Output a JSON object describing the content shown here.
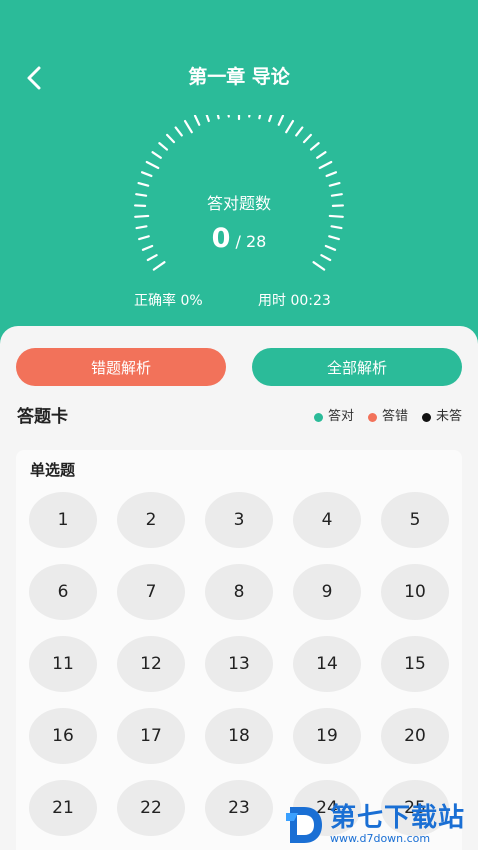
{
  "header": {
    "title": "第一章 导论",
    "back_icon": "chevron-left-icon"
  },
  "gauge": {
    "label": "答对题数",
    "correct": "0",
    "total_text": "/ 28",
    "progress_fraction": 0
  },
  "stats": {
    "accuracy": "正确率 0%",
    "time": "用时 00:23"
  },
  "actions": {
    "wrong_label": "错题解析",
    "all_label": "全部解析"
  },
  "answer_card": {
    "title": "答题卡",
    "legend": [
      {
        "label": "答对",
        "color": "#2bbb99"
      },
      {
        "label": "答错",
        "color": "#f2725a"
      },
      {
        "label": "未答",
        "color": "#111111"
      }
    ],
    "section_title": "单选题",
    "questions": [
      "1",
      "2",
      "3",
      "4",
      "5",
      "6",
      "7",
      "8",
      "9",
      "10",
      "11",
      "12",
      "13",
      "14",
      "15",
      "16",
      "17",
      "18",
      "19",
      "20",
      "21",
      "22",
      "23",
      "24",
      "25"
    ]
  },
  "watermark": {
    "main": "第七下载站",
    "sub": "www.d7down.com"
  },
  "colors": {
    "primary": "#2bbb99",
    "wrong": "#f2725a",
    "unanswered": "#111111"
  }
}
